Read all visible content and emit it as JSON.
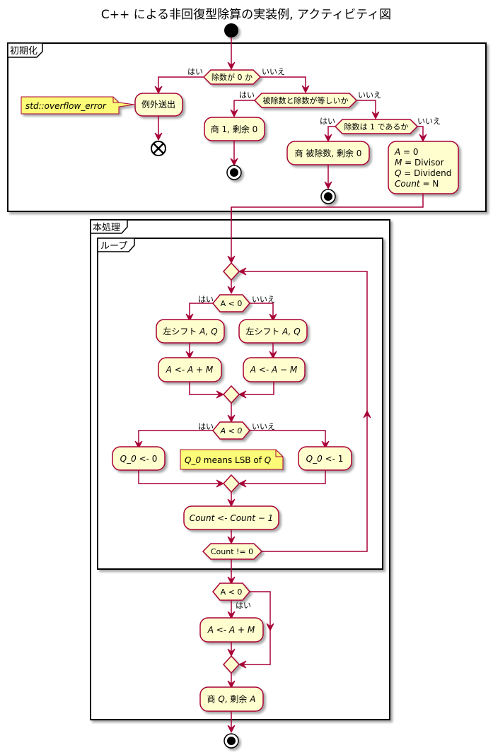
{
  "title": "C++ による非回復型除算の実装例, アクティビティ図",
  "colors": {
    "line": "#A80036",
    "activity_fill": "#FEFECE",
    "note_fill": "#FBFB77",
    "frame": "#000000"
  },
  "partitions": {
    "init": "初期化",
    "main": "本処理",
    "loop": "ループ"
  },
  "branch_labels": {
    "yes": "はい",
    "no": "いいえ"
  },
  "init": {
    "decision_divisor_zero": "除数が 0 か",
    "throw_exception": "例外送出",
    "exception_note": "std::overflow_error",
    "decision_equal": "被除数と除数が等しいか",
    "result_one": "商 1, 剰余 0",
    "decision_divisor_one": "除数は 1 であるか",
    "result_dividend": "商 被除数, 剰余 0",
    "setup": [
      {
        "var": "A",
        "eq": " = 0"
      },
      {
        "var": "M",
        "eq": " = Divisor"
      },
      {
        "var": "Q",
        "eq": " = Dividend"
      },
      {
        "var": "Count",
        "eq": " = N"
      }
    ]
  },
  "loop": {
    "decision_a_neg_1": "A < 0",
    "shift_left": "左シフト",
    "shift_vars": "A, Q",
    "add_m": "A <- A + M",
    "sub_m": "A <- A − M",
    "decision_a_neg_2": "A < 0",
    "q0_zero_var": "Q_0",
    "q0_zero_rest": " <- 0",
    "q0_one_var": "Q_0",
    "q0_one_rest": " <- 1",
    "note_var": "Q_0",
    "note_mid": " means LSB of ",
    "note_q": "Q",
    "decrement": "Count <- Count − 1",
    "decision_count": "Count != 0"
  },
  "post": {
    "decision_a_neg": "A < 0",
    "restore": "A <- A + M",
    "result_prefix": "商 ",
    "result_q": "Q",
    "result_mid": ", 剰余 ",
    "result_a": "A"
  }
}
